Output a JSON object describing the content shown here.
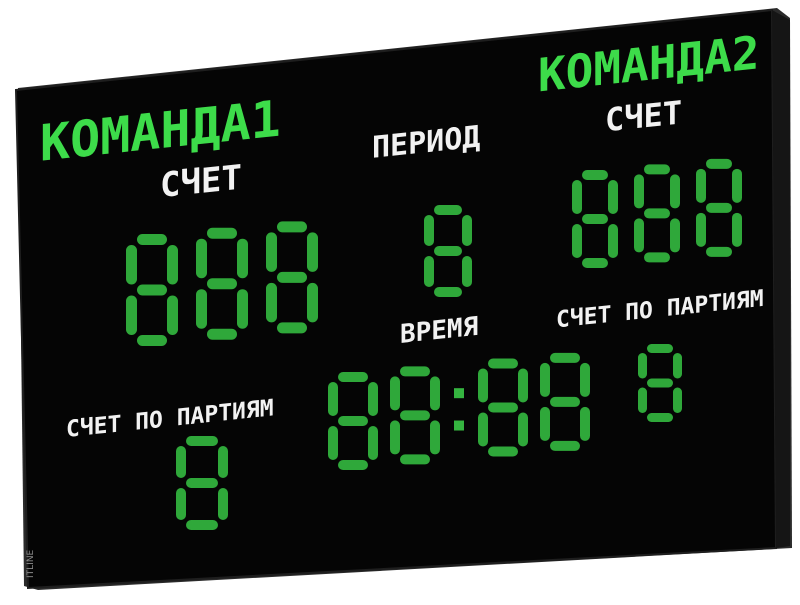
{
  "board": {
    "team1_name": "КОМАНДА1",
    "team2_name": "КОМАНДА2",
    "score_label_1": "СЧЕТ",
    "score_label_2": "СЧЕТ",
    "period_label": "ПЕРИОД",
    "time_label": "ВРЕМЯ",
    "sets_label_1": "СЧЕТ ПО ПАРТИЯМ",
    "sets_label_2": "СЧЕТ ПО ПАРТИЯМ",
    "team1_score": "888",
    "team2_score": "888",
    "period_value": "8",
    "time_value": "88:88",
    "team1_sets": "8",
    "team2_sets": "8",
    "brand_mark": "ITLINE"
  },
  "colors": {
    "panel": "#050505",
    "frame": "#1a1a1a",
    "led_green": "#3ddc4a",
    "led_white": "#f2f2f2"
  }
}
